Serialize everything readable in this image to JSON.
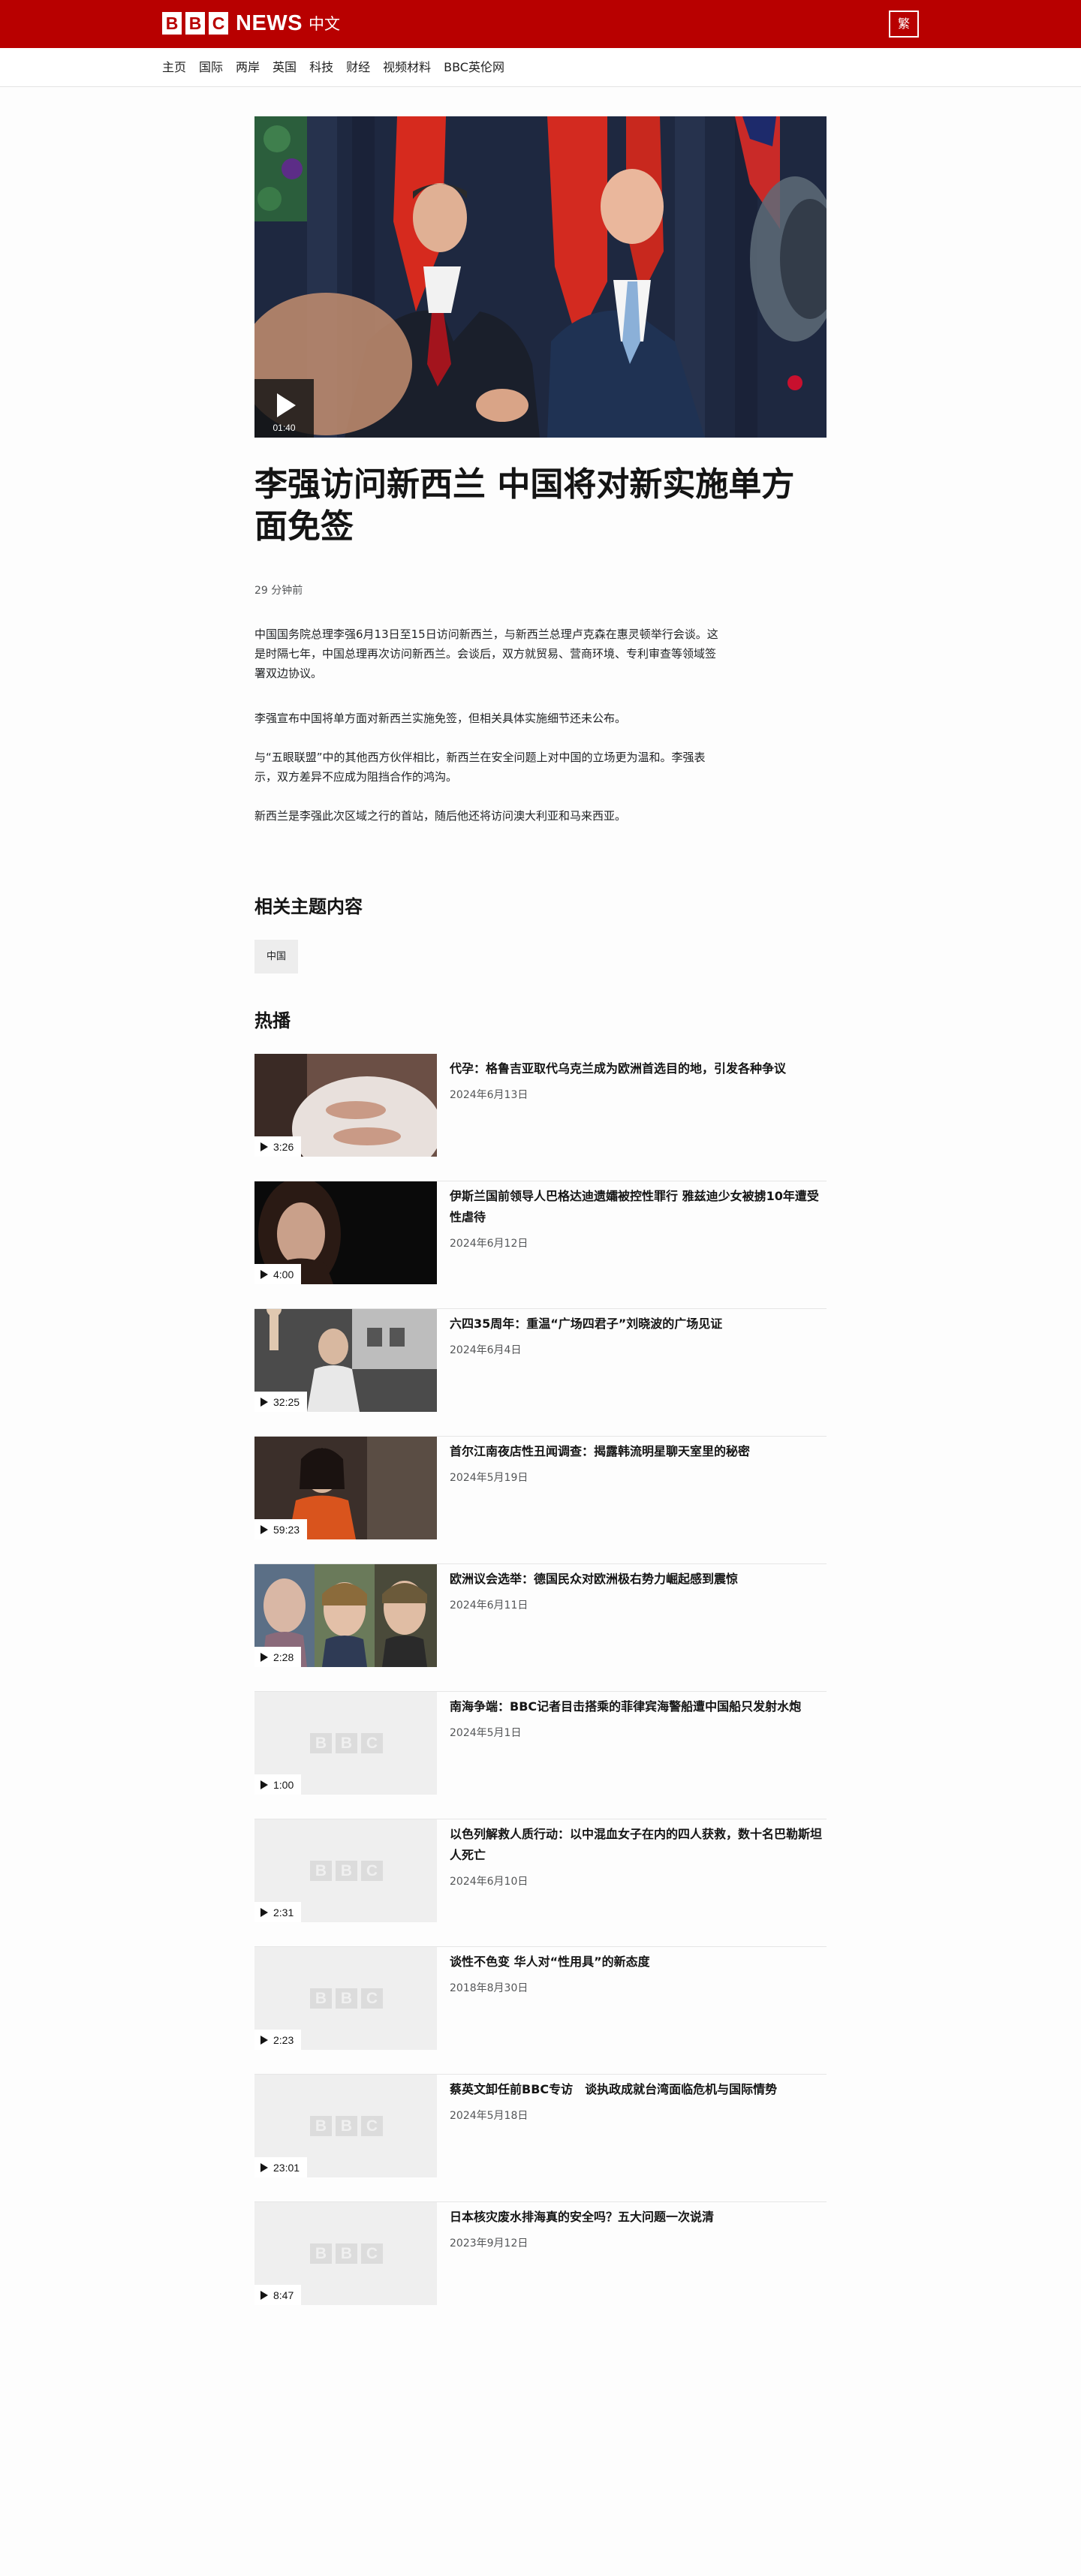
{
  "header": {
    "logo_letters": [
      "B",
      "B",
      "C"
    ],
    "logo_news": "NEWS",
    "logo_language": "中文",
    "script_toggle": "繁",
    "colors": {
      "brand_red": "#b80000"
    }
  },
  "nav": {
    "items": [
      "主页",
      "国际",
      "两岸",
      "英国",
      "科技",
      "财经",
      "视频材料",
      "BBC英伦网"
    ]
  },
  "hero": {
    "duration": "01:40",
    "play_icon": "play-icon"
  },
  "article": {
    "headline": "李强访问新西兰 中国将对新实施单方面免签",
    "timestamp": "29 分钟前",
    "paragraphs": [
      "中国国务院总理李强6月13日至15日访问新西兰，与新西兰总理卢克森在惠灵顿举行会谈。这是时隔七年，中国总理再次访问新西兰。会谈后，双方就贸易、营商环境、专利审查等领域签署双边协议。",
      "李强宣布中国将单方面对新西兰实施免签，但相关具体实施细节还未公布。",
      "与“五眼联盟”中的其他西方伙伴相比，新西兰在安全问题上对中国的立场更为温和。李强表示，双方差异不应成为阻挡合作的鸿沟。",
      "新西兰是李强此次区域之行的首站，随后他还将访问澳大利亚和马来西亚。"
    ]
  },
  "related": {
    "title": "相关主题内容",
    "topics": [
      "中国"
    ]
  },
  "most_watched": {
    "title": "热播",
    "items": [
      {
        "title": "代孕：格鲁吉亚取代乌克兰成为欧洲首选目的地，引发各种争议",
        "date": "2024年6月13日",
        "duration": "3:26"
      },
      {
        "title": "伊斯兰国前领导人巴格达迪遗孀被控性罪行 雅兹迪少女被掳10年遭受性虐待",
        "date": "2024年6月12日",
        "duration": "4:00"
      },
      {
        "title": "六四35周年：重温“广场四君子”刘晓波的广场见证",
        "date": "2024年6月4日",
        "duration": "32:25"
      },
      {
        "title": "首尔江南夜店性丑闻调查：揭露韩流明星聊天室里的秘密",
        "date": "2024年5月19日",
        "duration": "59:23"
      },
      {
        "title": "欧洲议会选举：德国民众对欧洲极右势力崛起感到震惊",
        "date": "2024年6月11日",
        "duration": "2:28"
      },
      {
        "title": "南海争端：BBC记者目击搭乘的菲律宾海警船遭中国船只发射水炮",
        "date": "2024年5月1日",
        "duration": "1:00"
      },
      {
        "title": "以色列解救人质行动：以中混血女子在内的四人获救，数十名巴勒斯坦人死亡",
        "date": "2024年6月10日",
        "duration": "2:31"
      },
      {
        "title": "谈性不色变 华人对“性用具”的新态度",
        "date": "2018年8月30日",
        "duration": "2:23"
      },
      {
        "title": "蔡英文卸任前BBC专访　谈执政成就台湾面临危机与国际情势",
        "date": "2024年5月18日",
        "duration": "23:01"
      },
      {
        "title": "日本核灾废水排海真的安全吗？五大问题一次说清",
        "date": "2023年9月12日",
        "duration": "8:47"
      }
    ]
  }
}
